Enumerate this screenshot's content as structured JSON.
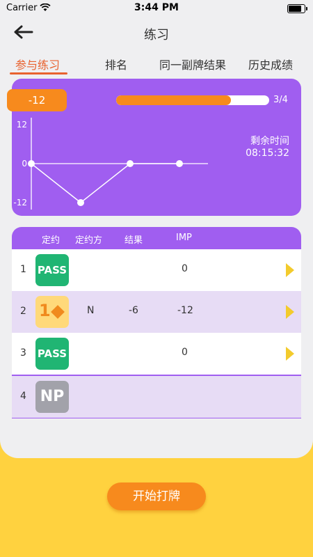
{
  "status_bar": {
    "carrier": "Carrier",
    "time": "3:44 PM"
  },
  "header": {
    "title": "练习"
  },
  "tabs": [
    {
      "label": "参与练习",
      "active": true
    },
    {
      "label": "排名",
      "active": false
    },
    {
      "label": "同一副牌结果",
      "active": false
    },
    {
      "label": "历史成绩",
      "active": false
    }
  ],
  "summary": {
    "score": "-12",
    "progress_text": "3/4",
    "progress_fraction": 0.75,
    "timer_label": "剩余时间",
    "timer_value": "08:15:32"
  },
  "chart_data": {
    "type": "line",
    "x": [
      1,
      2,
      3,
      4
    ],
    "series": [
      {
        "values": [
          0,
          -12,
          0,
          0
        ]
      }
    ],
    "yticks": [
      "12",
      "0",
      "-12"
    ],
    "ylim": [
      -12,
      12
    ]
  },
  "table": {
    "headers": [
      "定约",
      "定约方",
      "结果",
      "IMP"
    ],
    "rows": [
      {
        "num": "1",
        "contract": "PASS",
        "contract_type": "pass",
        "declarer": "",
        "result": "",
        "imp": "0",
        "has_arrow": true
      },
      {
        "num": "2",
        "contract": "1",
        "contract_type": "bid",
        "suit": "diamond",
        "declarer": "N",
        "result": "-6",
        "imp": "-12",
        "has_arrow": true
      },
      {
        "num": "3",
        "contract": "PASS",
        "contract_type": "pass",
        "declarer": "",
        "result": "",
        "imp": "0",
        "has_arrow": true
      },
      {
        "num": "4",
        "contract": "NP",
        "contract_type": "np",
        "declarer": "",
        "result": "",
        "imp": "",
        "has_arrow": false
      }
    ]
  },
  "start_button": {
    "label": "开始打牌"
  },
  "colors": {
    "accent": "#f78a1d",
    "purple": "#a05ef0",
    "tab_active": "#e8622f",
    "background": "#ffd23f"
  }
}
